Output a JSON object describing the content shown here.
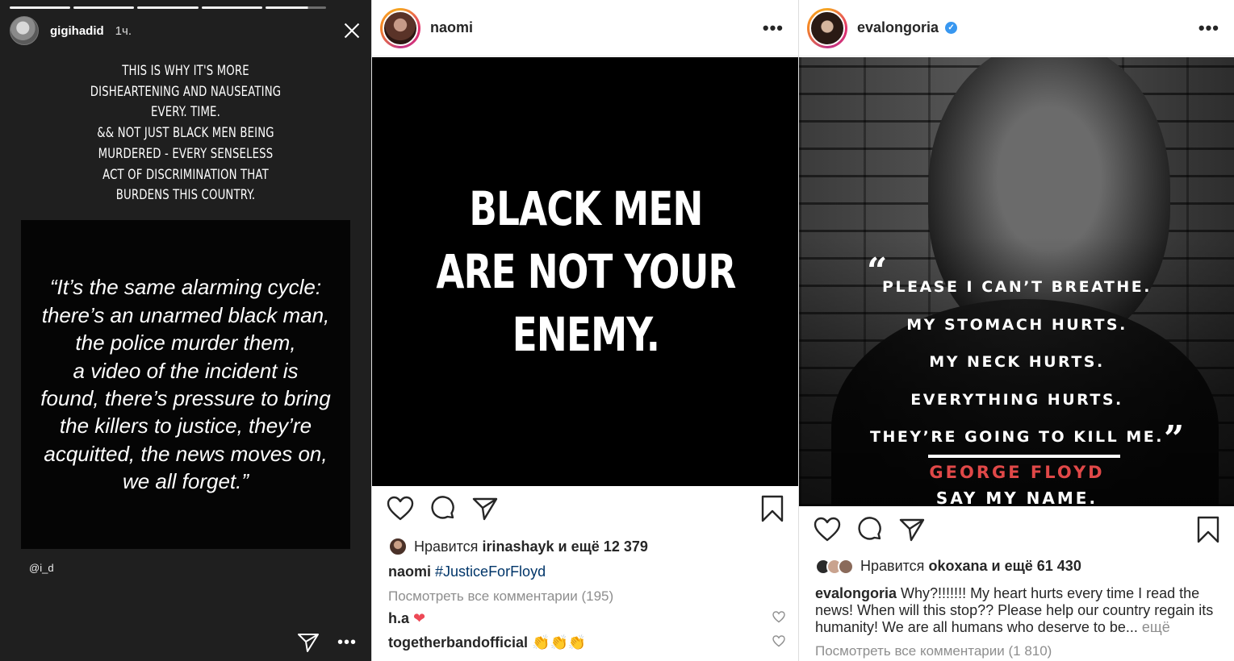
{
  "story": {
    "username": "gigihadid",
    "time": "1ч.",
    "caption": "THIS IS WHY IT'S MORE\nDISHEARTENING AND NAUSEATING\nEVERY. TIME.\n&& NOT JUST BLACK MEN BEING\nMURDERED - EVERY SENSELESS\nACT OF DISCRIMINATION THAT\nBURDENS THIS COUNTRY.",
    "quote": "“It’s the same alarming cycle:\nthere’s an unarmed black man,\nthe police murder them,\na video of the incident is\nfound, there’s pressure to bring\nthe killers to justice, they’re\nacquitted, the news moves on,\nwe all forget.”",
    "credit": "@i_d",
    "more": "•••"
  },
  "naomi": {
    "username": "naomi",
    "more": "•••",
    "image_text": "BLACK MEN\nARE NOT YOUR\nENEMY.",
    "likes_prefix": "Нравится",
    "likes_user": "irinashayk",
    "likes_suffix": "и ещё 12 379",
    "caption_user": "naomi",
    "caption_hashtag": "#JusticeForFloyd",
    "view_all": "Посмотреть все комментарии (195)",
    "comments": [
      {
        "user": "h.a",
        "text": "❤"
      },
      {
        "user": "togetherbandofficial",
        "text": "👏👏👏"
      }
    ]
  },
  "eva": {
    "username": "evalongoria",
    "verified_mark": "✓",
    "more": "•••",
    "quote_lines": [
      "PLEASE I CAN’T BREATHE.",
      "MY STOMACH HURTS.",
      "MY NECK HURTS.",
      "EVERYTHING HURTS.",
      "THEY’RE GOING TO KILL ME."
    ],
    "open_quote": "“",
    "close_quote": "”",
    "name": "GEORGE FLOYD",
    "say": "SAY MY NAME.",
    "likes_prefix": "Нравится",
    "likes_user": "okoxana",
    "likes_suffix": "и ещё 61 430",
    "caption_user": "evalongoria",
    "caption_text": "Why?!!!!!!! My heart hurts every time I read the news! When will this stop?? Please help our country regain its humanity!  We are all humans who deserve to be...",
    "caption_more": "ещё",
    "view_all": "Посмотреть все комментарии (1 810)"
  },
  "colors": {
    "story_bg": "#1f1f1f",
    "link": "#003569",
    "muted": "#8e8e8e",
    "heart_red": "#ed4956",
    "floyd_red": "#e04848"
  }
}
